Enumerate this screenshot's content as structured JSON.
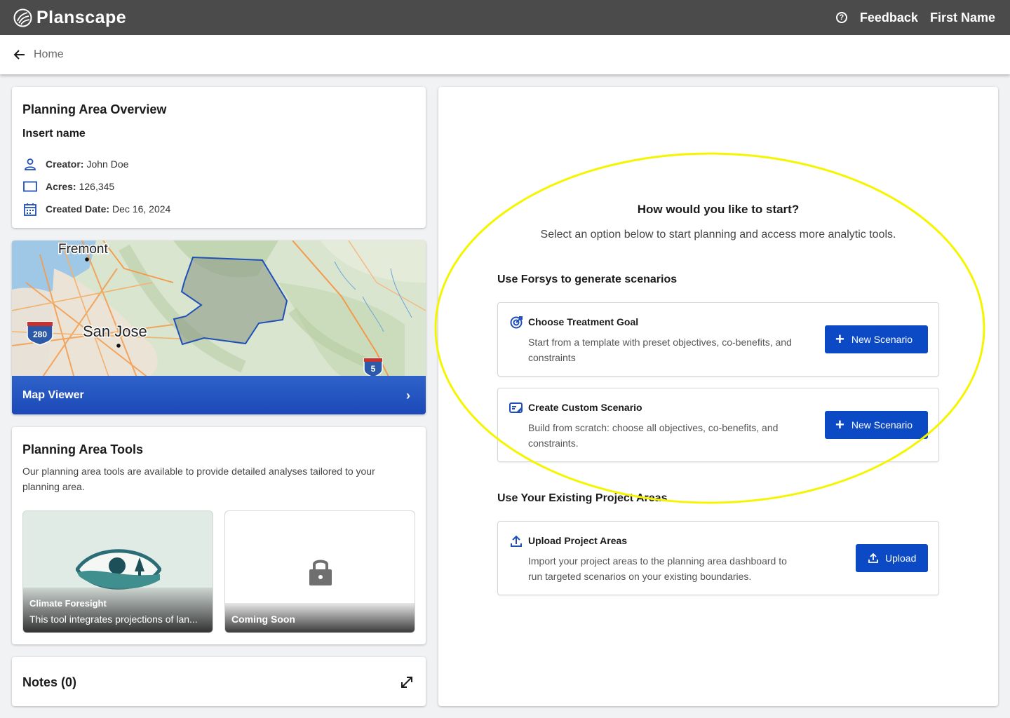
{
  "header": {
    "app_name": "Planscape",
    "feedback": "Feedback",
    "user_name": "First Name",
    "help_icon": "help-circle-icon"
  },
  "breadcrumb": {
    "home": "Home"
  },
  "overview": {
    "title": "Planning Area Overview",
    "name": "Insert name",
    "creator_label": "Creator:",
    "creator_value": "John Doe",
    "acres_label": "Acres:",
    "acres_value": "126,345",
    "created_label": "Created Date:",
    "created_value": "Dec 16, 2024"
  },
  "map": {
    "viewer_label": "Map Viewer",
    "places": [
      "Fremont",
      "San Jose"
    ],
    "shields": [
      "280",
      "5"
    ]
  },
  "tools": {
    "title": "Planning Area Tools",
    "description": "Our planning area tools are available to provide detailed analyses tailored to your planning area.",
    "tiles": [
      {
        "name": "Climate Foresight",
        "text": "This tool integrates projections of lan..."
      },
      {
        "name": "Coming Soon"
      }
    ]
  },
  "notes": {
    "title": "Notes (0)"
  },
  "start": {
    "title": "How would you like to start?",
    "subtitle": "Select an option below to start planning and access more analytic tools.",
    "forsys_section": "Use Forsys to generate scenarios",
    "existing_section": "Use Your Existing Project Areas",
    "options": [
      {
        "title": "Choose Treatment Goal",
        "desc": "Start from a template with preset objectives, co-benefits, and constraints",
        "button": "New Scenario"
      },
      {
        "title": "Create Custom Scenario",
        "desc": "Build from scratch: choose all objectives, co-benefits, and constraints.",
        "button": "New Scenario"
      },
      {
        "title": "Upload Project Areas",
        "desc": "Import your project areas to the planning area dashboard to run targeted scenarios on your existing boundaries.",
        "button": "Upload"
      }
    ]
  },
  "colors": {
    "primary": "#0b4ac4",
    "topbar": "#4b4b4b",
    "highlight": "#f5f500"
  }
}
